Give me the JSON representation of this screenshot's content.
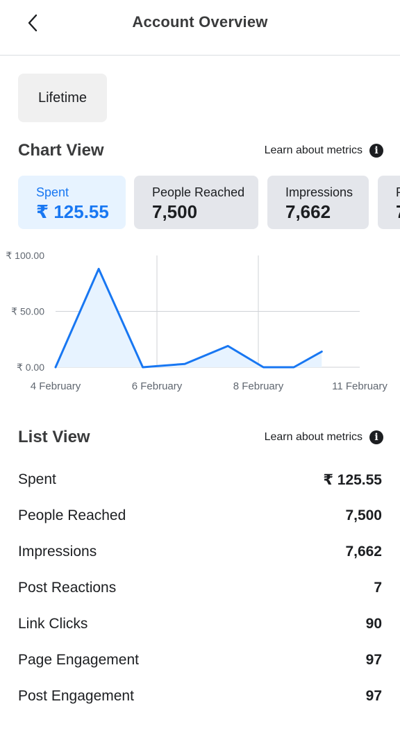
{
  "header": {
    "title": "Account Overview"
  },
  "date_range": {
    "label": "Lifetime"
  },
  "chart_view": {
    "title": "Chart View",
    "learn_label": "Learn about metrics"
  },
  "metric_tabs": [
    {
      "label": "Spent",
      "value": "₹ 125.55"
    },
    {
      "label": "People Reached",
      "value": "7,500"
    },
    {
      "label": "Impressions",
      "value": "7,662"
    },
    {
      "label": "P",
      "value": "7"
    }
  ],
  "chart_data": {
    "type": "area",
    "series": [
      {
        "x": [
          0,
          1,
          2,
          3,
          4,
          5,
          6,
          7,
          8,
          9,
          10,
          11,
          12
        ],
        "values": [
          0,
          88,
          0,
          0,
          0,
          0,
          2,
          0,
          0,
          0,
          18,
          0,
          0
        ]
      }
    ],
    "points": [
      [
        0,
        0
      ],
      [
        0.85,
        88
      ],
      [
        1.72,
        0
      ],
      [
        2.0,
        1
      ],
      [
        2.55,
        3
      ],
      [
        3.4,
        19
      ],
      [
        4.1,
        0
      ],
      [
        4.7,
        0
      ],
      [
        5.25,
        14
      ]
    ],
    "x_ticks": [
      {
        "pos": 0,
        "label": "4 February"
      },
      {
        "pos": 2,
        "label": "6 February"
      },
      {
        "pos": 4,
        "label": "8 February"
      },
      {
        "pos": 6,
        "label": "11 February"
      }
    ],
    "y_ticks": [
      {
        "value": 0,
        "label": "₹ 0.00"
      },
      {
        "value": 50,
        "label": "₹ 50.00"
      },
      {
        "value": 100,
        "label": "₹ 100.00"
      }
    ],
    "ylim": [
      0,
      100
    ],
    "xlim": [
      0,
      6
    ],
    "color": "#1877f2",
    "fill": "#e7f3ff",
    "grid": true
  },
  "list_view": {
    "title": "List View",
    "learn_label": "Learn about metrics",
    "rows": [
      {
        "label": "Spent",
        "value": "₹ 125.55"
      },
      {
        "label": "People Reached",
        "value": "7,500"
      },
      {
        "label": "Impressions",
        "value": "7,662"
      },
      {
        "label": "Post Reactions",
        "value": "7"
      },
      {
        "label": "Link Clicks",
        "value": "90"
      },
      {
        "label": "Page Engagement",
        "value": "97"
      },
      {
        "label": "Post Engagement",
        "value": "97"
      }
    ]
  }
}
